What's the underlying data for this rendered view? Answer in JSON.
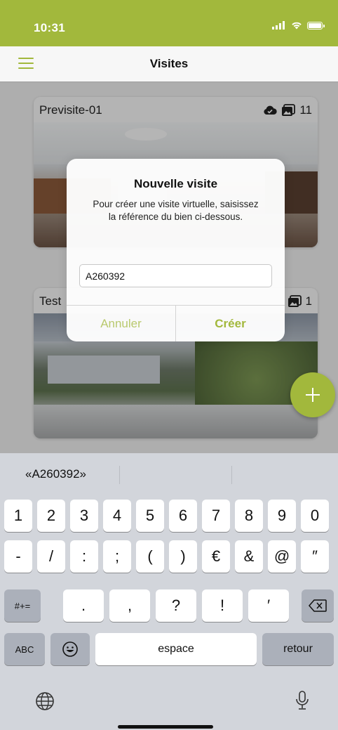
{
  "status_bar": {
    "time": "10:31"
  },
  "nav": {
    "title": "Visites"
  },
  "cards": [
    {
      "title": "Previsite-01",
      "photo_count": "11"
    },
    {
      "title": "Test",
      "photo_count": "1"
    }
  ],
  "dialog": {
    "title": "Nouvelle visite",
    "message": "Pour créer une visite virtuelle, saisissez la référence du bien ci-dessous.",
    "input_value": "A260392",
    "cancel_label": "Annuler",
    "create_label": "Créer"
  },
  "keyboard": {
    "suggestion": "«A260392»",
    "row1": [
      "1",
      "2",
      "3",
      "4",
      "5",
      "6",
      "7",
      "8",
      "9",
      "0"
    ],
    "row2": [
      "-",
      "/",
      ":",
      ";",
      "(",
      ")",
      "€",
      "&",
      "@",
      "″"
    ],
    "row3": [
      ".",
      ",",
      "?",
      "!",
      "′"
    ],
    "symbols_key": "#+=",
    "abc_key": "ABC",
    "space_label": "espace",
    "return_label": "retour"
  },
  "colors": {
    "accent": "#a2b83c",
    "accent_light": "#b9c96e",
    "keyboard_bg": "#d2d5db"
  },
  "icons": [
    "menu-icon",
    "cloud-icon",
    "photos-icon",
    "plus-icon",
    "delete-icon",
    "emoji-icon",
    "globe-icon",
    "microphone-icon"
  ]
}
